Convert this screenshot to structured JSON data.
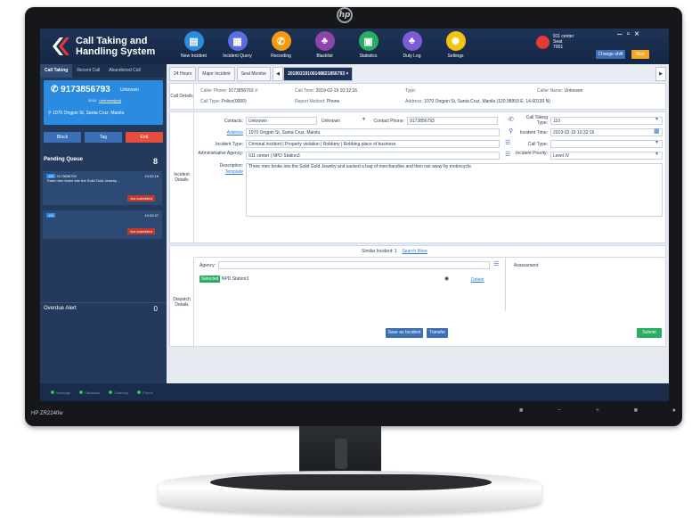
{
  "monitor": {
    "model": "HP ZR2240w"
  },
  "app": {
    "title_line1": "Call Taking and",
    "title_line2": "Handling System",
    "nav": [
      {
        "label": "New Incident",
        "icon": "new-incident-icon",
        "color": "#2a8be0"
      },
      {
        "label": "Incident Query",
        "icon": "incident-query-icon",
        "color": "#5b6ee1"
      },
      {
        "label": "Recording",
        "icon": "recording-icon",
        "color": "#f39c12"
      },
      {
        "label": "Blacklist",
        "icon": "blacklist-icon",
        "color": "#8e44ad"
      },
      {
        "label": "Statistics",
        "icon": "statistics-icon",
        "color": "#27ae60"
      },
      {
        "label": "Duty Log",
        "icon": "duty-log-icon",
        "color": "#7b5cd6"
      },
      {
        "label": "Settings",
        "icon": "settings-icon",
        "color": "#f1c40f"
      }
    ],
    "user": {
      "line1": "911 center",
      "line2": "Seat",
      "line3": "7001"
    },
    "change_shift": "Change shift",
    "stop": "Stop"
  },
  "sidebar": {
    "tabs": [
      "Call Taking",
      "Recent Call",
      "Abandoned Call"
    ],
    "call": {
      "number": "9173856793",
      "unknown": "Unknown",
      "sub1": "2018",
      "sub2": "Unknown(md)",
      "address": "1070 Ongpin St, Santa Cruz, Manila"
    },
    "buttons": [
      {
        "label": "Block",
        "color": "#3b6fb6"
      },
      {
        "label": "Tag",
        "color": "#3b6fb6"
      },
      {
        "label": "End",
        "color": "#e74c3c"
      }
    ],
    "queue": {
      "title": "Pending Queue",
      "count": "8",
      "items": [
        {
          "tag": "110",
          "number": "9173856793",
          "time": "10:32:16",
          "desc": "Three men broke into the Solid Gold Jewelry...",
          "status": "Not submitted"
        },
        {
          "tag": "110",
          "number": "",
          "time": "10:22:47",
          "desc": "",
          "status": "Not submitted"
        }
      ]
    },
    "overdue": {
      "title": "Overdue Alert",
      "count": "0"
    }
  },
  "status": [
    "Message",
    "Database",
    "Gateway",
    "Phone"
  ],
  "tabs": [
    "24 Hours",
    "Major Incident",
    "Seat Monitor",
    "20190219100148821856793"
  ],
  "call_details": {
    "label": "Call Details",
    "caller_phone_label": "Caller Phone:",
    "caller_phone": "9173856793",
    "call_time_label": "Call Time:",
    "call_time": "2019-02-19 10:32:16",
    "type_label": "Type:",
    "type_value": "",
    "caller_name_label": "Caller Name:",
    "caller_name": "Unknown",
    "call_type_label": "Call Type:",
    "call_type": "Police(9000)",
    "report_method_label": "Report Method:",
    "report_method": "Phone",
    "address_label": "Address:",
    "address": "1070 Ongpin St, Santa Cruz, Manila (120.98959 E, 14.60139 N)"
  },
  "incident": {
    "label": "Incident Details",
    "contacts_label": "Contacts:",
    "contacts": "Unknown",
    "unknown_label": "Unknown",
    "contact_phone_label": "Contact Phone:",
    "contact_phone": "9173856793",
    "call_taking_type_label": "Call Taking Type:",
    "call_taking_type": "110",
    "address_label": "Address",
    "address": "1070 Ongpin St, Santa Cruz, Manila",
    "incident_time_label": "Incident Time:",
    "incident_time": "2019-02-19 10:32:16",
    "incident_type_label": "Incident Type:",
    "incident_type": "Criminal incident | Property violation | Robbery | Robbing place of business",
    "case_type_label": "Call Type:",
    "case_type": "",
    "agency_label": "Administrative Agency:",
    "agency": "911 center | NPD Station3",
    "priority_label": "Incident Priority:",
    "priority": "Level IV",
    "description_label": "Description:",
    "template_label": "Template",
    "description": "Three men broke into the Solid Gold Jewelry and sacked a bag of merchandise and then ran away by motorcycle."
  },
  "similar": {
    "label": "Similar Incident:",
    "count": "1",
    "search_more": "Search More"
  },
  "dispatch": {
    "label": "Dispatch Details",
    "agency_label": "Agency:",
    "assessment_label": "Assessment",
    "chip": "Selected",
    "station": "NPD Station3",
    "delete": "Delete",
    "save_btn": "Save as Incident",
    "transfer_btn": "Transfer",
    "submit_btn": "Submit"
  }
}
